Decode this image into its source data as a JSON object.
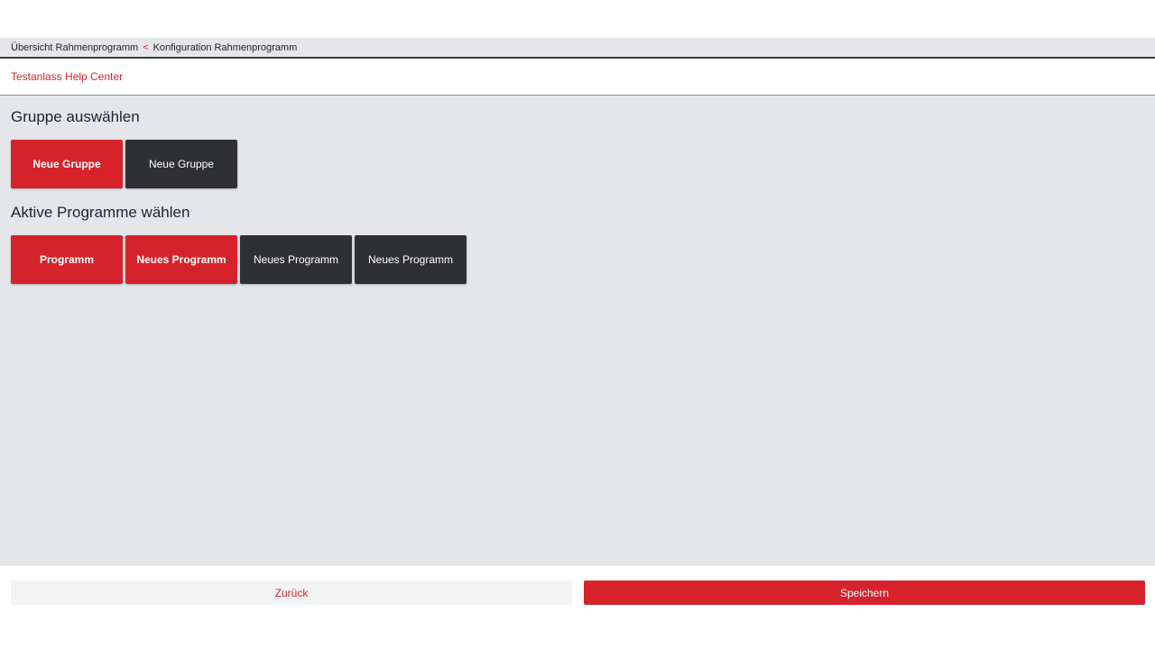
{
  "breadcrumb": {
    "items": [
      "Übersicht Rahmenprogramm",
      "Konfiguration Rahmenprogramm"
    ],
    "separator": "<"
  },
  "subheader": {
    "title": "Testanlass Help Center"
  },
  "group_section": {
    "title": "Gruppe auswählen",
    "buttons": [
      {
        "label": "Neue Gruppe",
        "state": "active"
      },
      {
        "label": "Neue Gruppe",
        "state": "inactive"
      }
    ]
  },
  "program_section": {
    "title": "Aktive Programme wählen",
    "buttons": [
      {
        "label": "Programm",
        "state": "active"
      },
      {
        "label": "Neues Programm",
        "state": "active"
      },
      {
        "label": "Neues Programm",
        "state": "inactive"
      },
      {
        "label": "Neues Programm",
        "state": "inactive"
      }
    ]
  },
  "footer": {
    "back_label": "Zurück",
    "save_label": "Speichern"
  },
  "colors": {
    "accent": "#d6232b",
    "dark": "#2f3033",
    "background": "#e5e6ea"
  }
}
